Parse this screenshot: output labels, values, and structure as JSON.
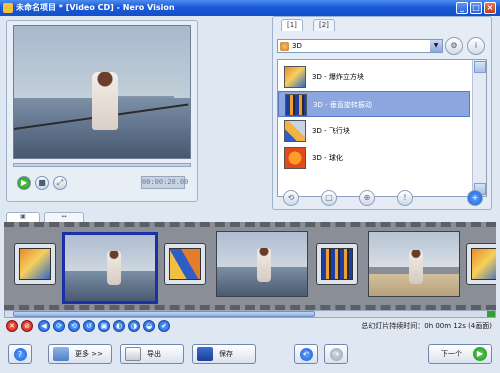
{
  "window": {
    "title": "未命名项目 * [Video CD] - Nero Vision",
    "min_label": "_",
    "max_label": "□",
    "close_label": "×"
  },
  "preview": {
    "timecode": "00:00:20.00",
    "play_icon": "▶",
    "stop_icon": "■",
    "fullscreen_icon": "⤢"
  },
  "effects": {
    "tabs": [
      "[1]",
      "[2]"
    ],
    "category_select": "3D",
    "items": [
      {
        "label": "3D - 爆炸立方块",
        "selected": false
      },
      {
        "label": "3D - 垂直旋转振动",
        "selected": true
      },
      {
        "label": "3D - 飞行块",
        "selected": false
      },
      {
        "label": "3D - 球化",
        "selected": false
      }
    ],
    "bottom_buttons": [
      "⟲",
      "▢",
      "⊕",
      "!",
      "+"
    ]
  },
  "storyboard_tabs": [
    "▣",
    "↔"
  ],
  "toolbar_icons": [
    "✕",
    "⊘",
    "◀",
    "⟳",
    "⟲",
    "↺",
    "▣",
    "◐",
    "◑",
    "◒",
    "✔"
  ],
  "duration_text": "总幻灯片持续时间：0h 00m 12s (4画面)",
  "buttons": {
    "help": "?",
    "more": "更多 >>",
    "export": "导出",
    "save": "保存",
    "undo": "↶",
    "redo": "↷",
    "next": "下一个"
  },
  "colors": {
    "titlebar": "#1958d8",
    "selection": "#8ca7df",
    "storyboard_bg": "#8a8f97",
    "selected_frame": "#1a2fa8"
  }
}
